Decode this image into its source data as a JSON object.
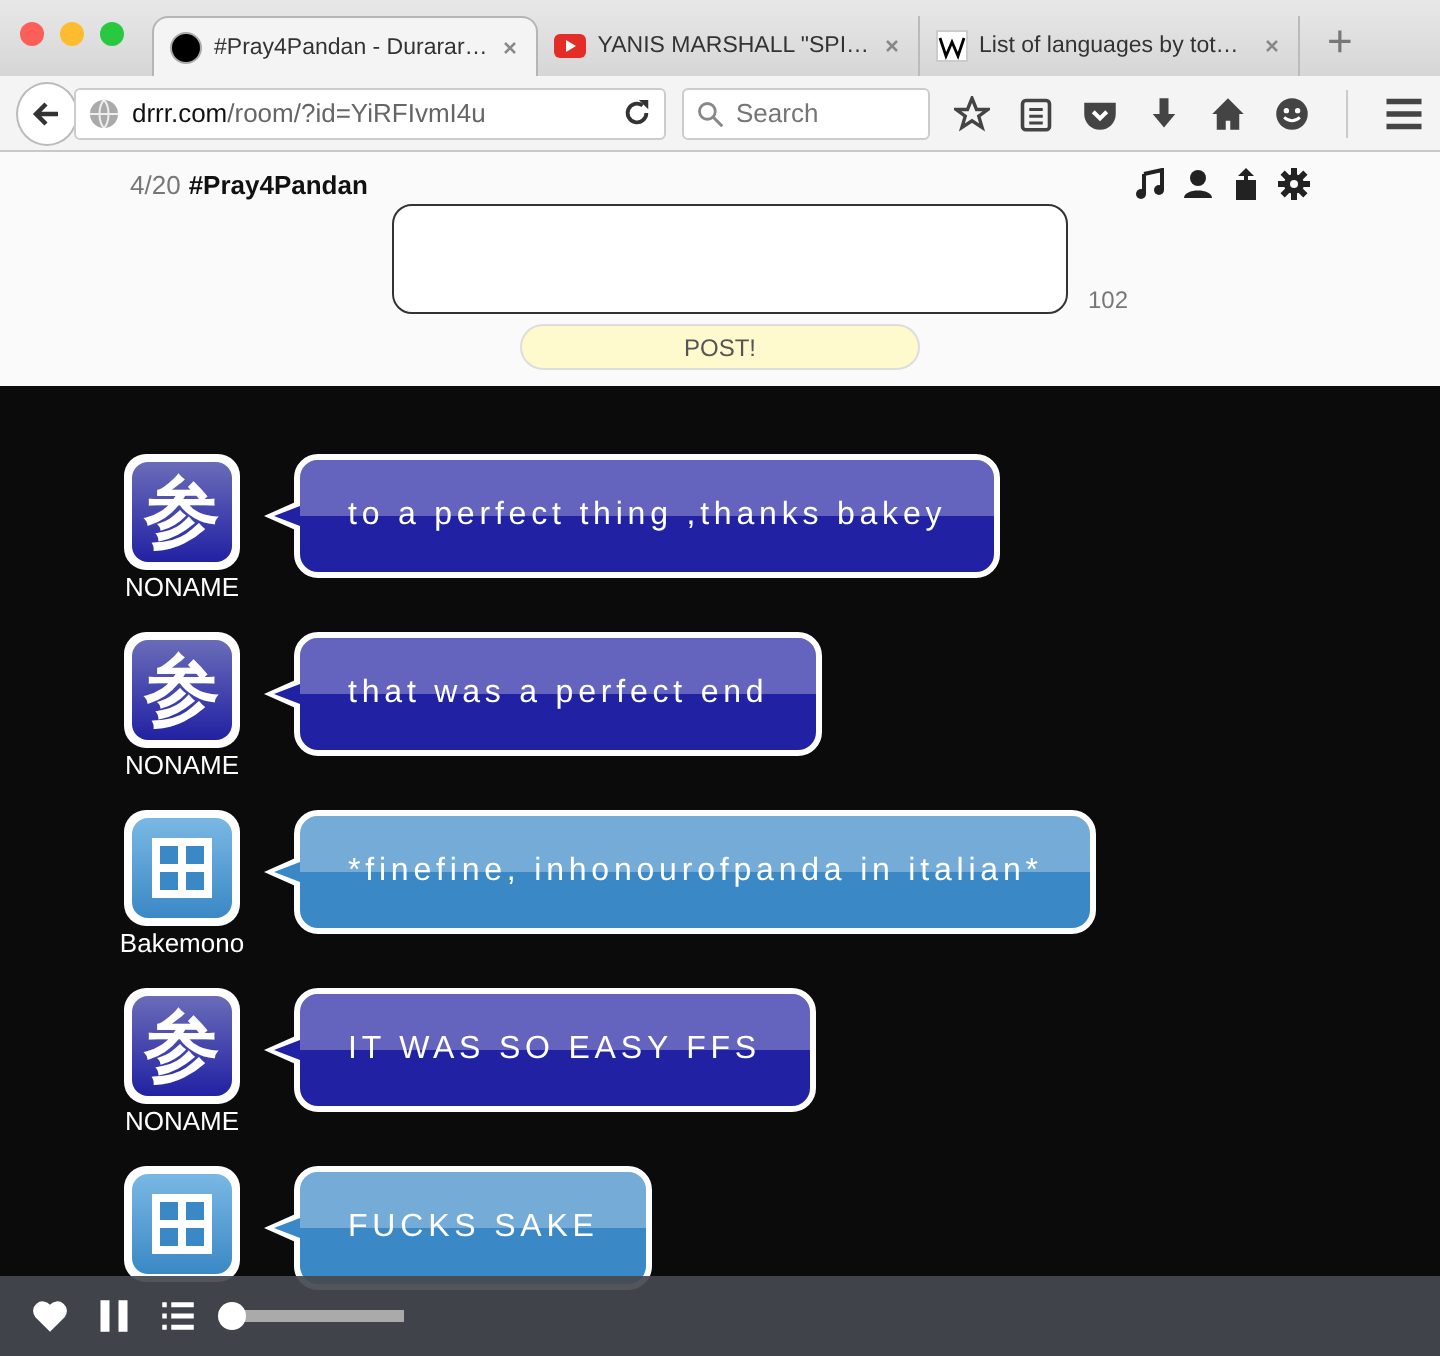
{
  "browser": {
    "tabs": [
      {
        "title": "#Pray4Pandan - Durarar…",
        "kind": "circle",
        "selected": true
      },
      {
        "title": "YANIS MARSHALL \"SPI…",
        "kind": "video",
        "selected": false
      },
      {
        "title": "List of languages by tot…",
        "kind": "wiki",
        "selected": false
      }
    ],
    "new_tab": "+",
    "url_host": "drrr.com",
    "url_path": "/room/?id=YiRFIvmI4u",
    "search": {
      "placeholder": "Search"
    }
  },
  "room": {
    "count": "4/20",
    "name": "#Pray4Pandan",
    "remaining": "102",
    "post_button": "POST!"
  },
  "messages": [
    {
      "user": "NONAME",
      "kind": "kanji",
      "avatar_char": "参",
      "color": "#2121a3",
      "text": "to a perfect thing ,thanks bakey"
    },
    {
      "user": "NONAME",
      "kind": "kanji",
      "avatar_char": "参",
      "color": "#2121a3",
      "text": "that was a perfect end"
    },
    {
      "user": "Bakemono",
      "kind": "grid",
      "color": "#3a88c6",
      "text": "*finefine, inhonourofpanda in italian*"
    },
    {
      "user": "NONAME",
      "kind": "kanji",
      "avatar_char": "参",
      "color": "#2121a3",
      "text": "IT WAS SO EASY FFS"
    },
    {
      "kind": "grid",
      "color": "#3a88c6",
      "text": "FUCKS SAKE"
    }
  ],
  "player": {
    "level": 0.0
  }
}
